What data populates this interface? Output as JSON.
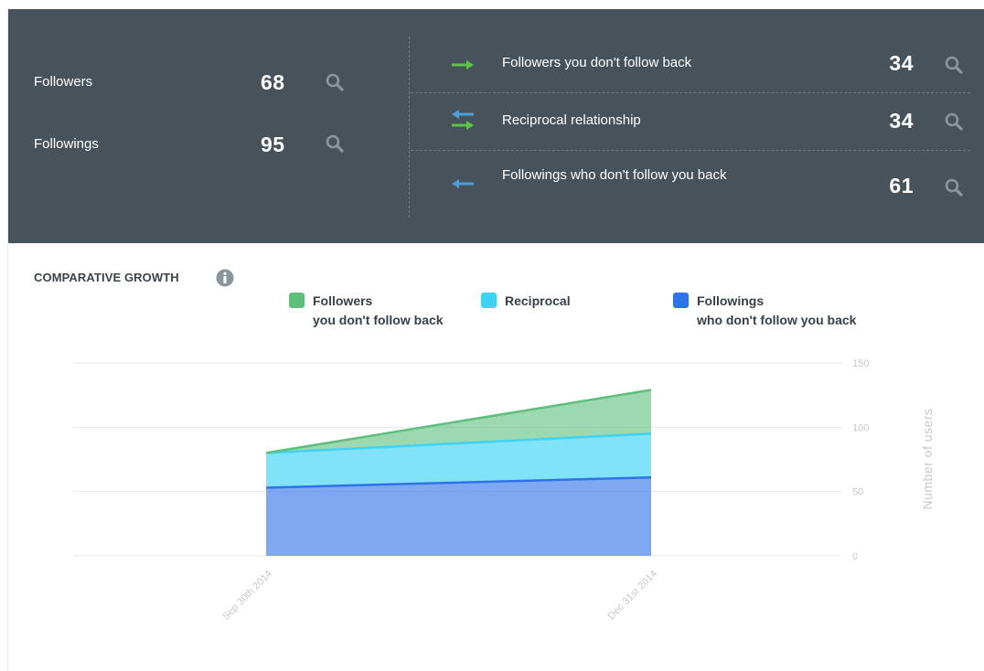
{
  "stats": {
    "left": [
      {
        "label": "Followers",
        "value": "68"
      },
      {
        "label": "Followings",
        "value": "95"
      }
    ],
    "right": [
      {
        "label": "Followers you don't follow back",
        "value": "34",
        "arrow": "right-arrow-green"
      },
      {
        "label": "Reciprocal relationship",
        "value": "34",
        "arrow": "bidirectional-arrows"
      },
      {
        "label": "Followings who don't follow you back",
        "value": "61",
        "arrow": "left-arrow-blue"
      }
    ],
    "icon": "search-icon"
  },
  "chart_section": {
    "title": "COMPARATIVE GROWTH",
    "info_icon": "info-icon"
  },
  "chart_data": {
    "type": "area",
    "stacked": true,
    "title": "COMPARATIVE GROWTH",
    "x": [
      "Sep 30th 2014",
      "Dec 31st 2014"
    ],
    "ylabel": "Number of users",
    "ylim": [
      0,
      150
    ],
    "yticks": [
      0,
      50,
      100,
      150
    ],
    "ytick_labels": [
      "0",
      "50",
      "100",
      "150"
    ],
    "grid": true,
    "legend_position": "top",
    "series": [
      {
        "name": "Followers\nyou don't follow back",
        "values": [
          0,
          34
        ],
        "color": "#5cbf7c"
      },
      {
        "name": "Reciprocal",
        "values": [
          27,
          34
        ],
        "color": "#3fd2f5"
      },
      {
        "name": "Followings\nwho don't follow you back",
        "values": [
          53,
          61
        ],
        "color": "#2f73e8"
      }
    ]
  }
}
